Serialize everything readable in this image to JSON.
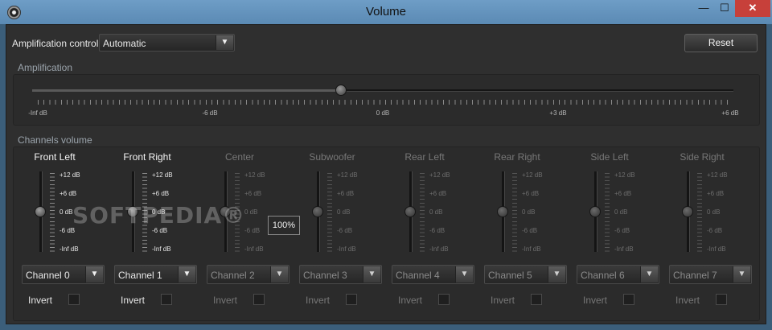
{
  "window": {
    "title": "Volume",
    "minimize": "—",
    "maximize": "☐",
    "close": "✕"
  },
  "amplification_control": {
    "label": "Amplification control:",
    "value": "Automatic"
  },
  "reset_label": "Reset",
  "amplification": {
    "title": "Amplification",
    "level_fraction": 0.44,
    "tick_labels": [
      "-Inf dB",
      "-6 dB",
      "0 dB",
      "+3 dB",
      "+6 dB"
    ]
  },
  "channels_title": "Channels volume",
  "tooltip": "100%",
  "watermark": "SOFTPEDIA®",
  "db_labels": [
    "+12 dB",
    "+6 dB",
    "0 dB",
    "-6 dB",
    "-Inf dB"
  ],
  "invert_label": "Invert",
  "channels": [
    {
      "name": "Front Left",
      "channel": "Channel 0",
      "active": true,
      "level": 0.5
    },
    {
      "name": "Front Right",
      "channel": "Channel 1",
      "active": true,
      "level": 0.5
    },
    {
      "name": "Center",
      "channel": "Channel 2",
      "active": false,
      "level": 0.5
    },
    {
      "name": "Subwoofer",
      "channel": "Channel 3",
      "active": false,
      "level": 0.5
    },
    {
      "name": "Rear Left",
      "channel": "Channel 4",
      "active": false,
      "level": 0.5
    },
    {
      "name": "Rear Right",
      "channel": "Channel 5",
      "active": false,
      "level": 0.5
    },
    {
      "name": "Side Left",
      "channel": "Channel 6",
      "active": false,
      "level": 0.5
    },
    {
      "name": "Side Right",
      "channel": "Channel 7",
      "active": false,
      "level": 0.5
    }
  ]
}
